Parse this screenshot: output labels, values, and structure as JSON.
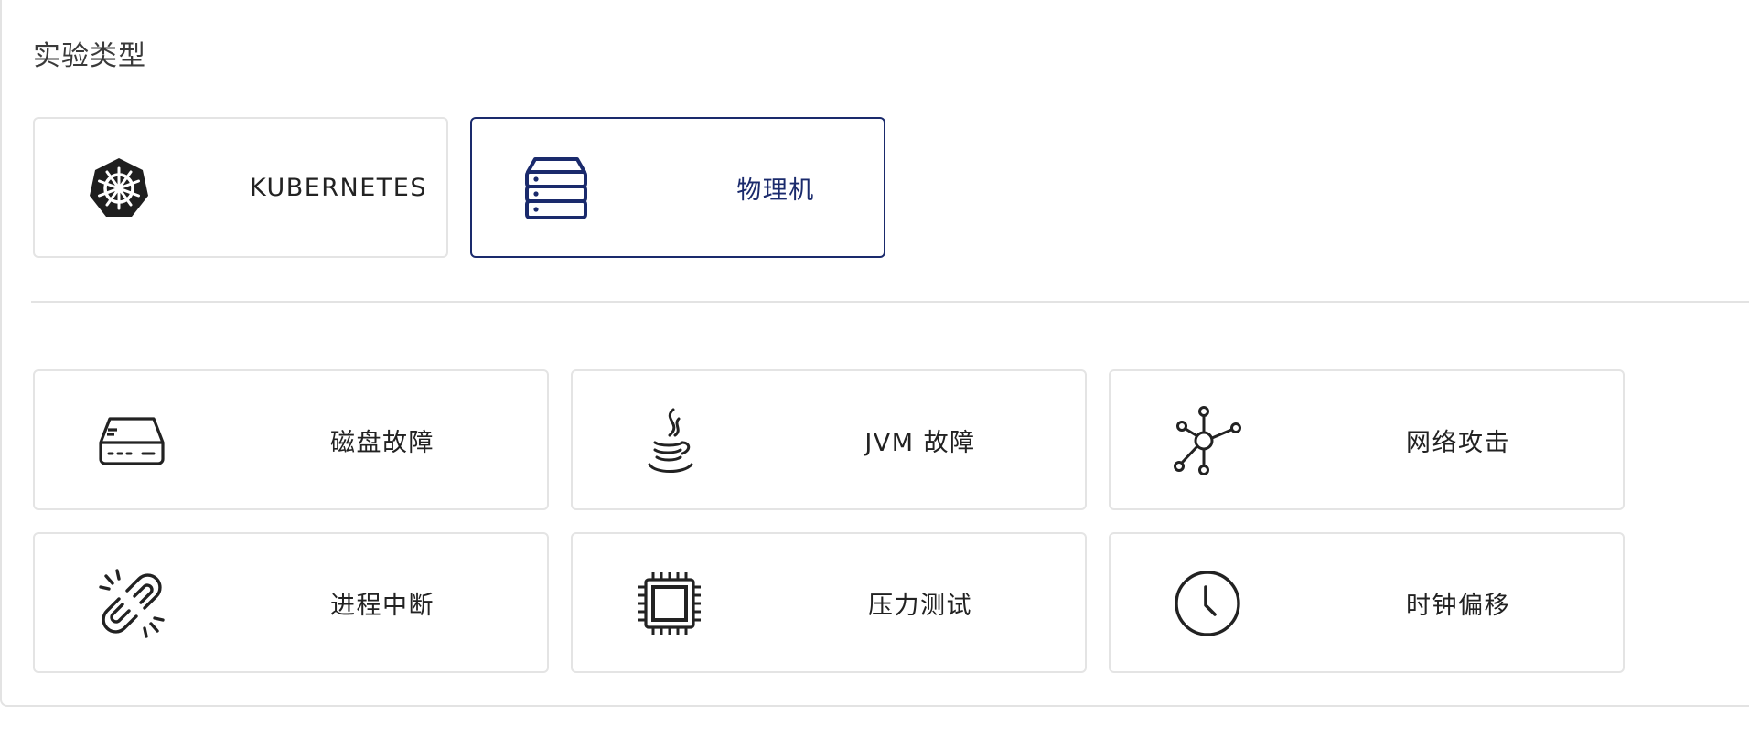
{
  "section": {
    "title": "实验类型"
  },
  "experiment_types": [
    {
      "label": "KUBERNETES",
      "icon": "kubernetes-icon",
      "selected": false
    },
    {
      "label": "物理机",
      "icon": "server-icon",
      "selected": true
    }
  ],
  "fault_types": [
    {
      "label": "磁盘故障",
      "icon": "hard-drive-icon"
    },
    {
      "label": "JVM 故障",
      "icon": "java-icon"
    },
    {
      "label": "网络攻击",
      "icon": "network-icon"
    },
    {
      "label": "进程中断",
      "icon": "broken-link-icon"
    },
    {
      "label": "压力测试",
      "icon": "cpu-chip-icon"
    },
    {
      "label": "时钟偏移",
      "icon": "clock-icon"
    }
  ],
  "colors": {
    "selected_border": "#1a2a6c",
    "selected_text": "#1a2a6c",
    "card_border": "#e4e4e4",
    "icon_stroke": "#222222"
  }
}
